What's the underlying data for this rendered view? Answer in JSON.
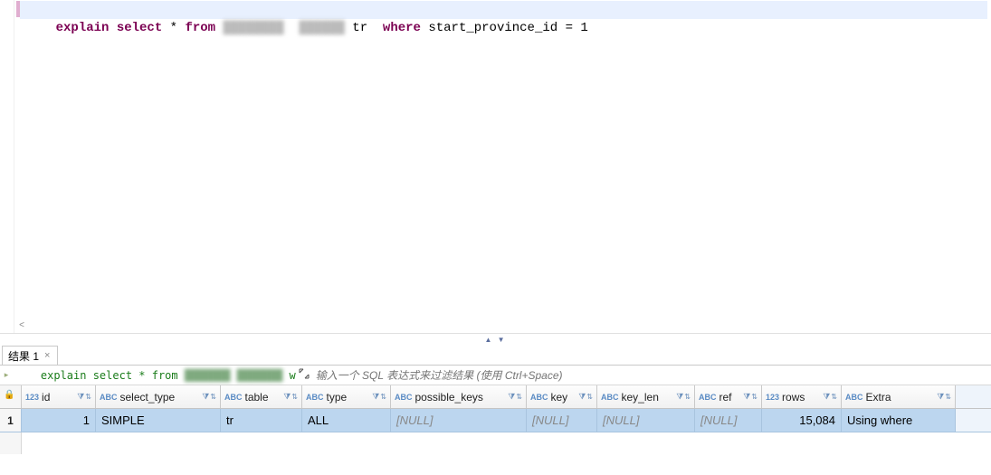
{
  "editor": {
    "sql": {
      "kw_explain": "explain",
      "kw_select": "select",
      "star": " * ",
      "kw_from": "from",
      "blurred_table": "████████  ██████",
      "alias": " tr  ",
      "kw_where": "where",
      "predicate": " start_province_id = 1"
    }
  },
  "splitter": {
    "handle": "▲ ▼"
  },
  "tabs": {
    "result1_label": "结果 1",
    "close_glyph": "×"
  },
  "filter_bar": {
    "tree_glyph": "▸",
    "sql_prefix": "explain select * from ",
    "sql_blurred": "███████ ███████",
    "sql_suffix": " w",
    "placeholder": "输入一个 SQL 表达式来过滤结果 (使用 Ctrl+Space)"
  },
  "grid": {
    "lock_glyph": "🔒",
    "type_num": "123",
    "type_txt": "ABC",
    "filter_glyph": "⧩",
    "sort_glyph": "⇅",
    "columns": {
      "id": "id",
      "select_type": "select_type",
      "table": "table",
      "type": "type",
      "possible_keys": "possible_keys",
      "key": "key",
      "key_len": "key_len",
      "ref": "ref",
      "rows": "rows",
      "extra": "Extra"
    },
    "rownum": "1",
    "row": {
      "id": "1",
      "select_type": "SIMPLE",
      "table": "tr",
      "type": "ALL",
      "possible_keys": "[NULL]",
      "key": "[NULL]",
      "key_len": "[NULL]",
      "ref": "[NULL]",
      "rows": "15,084",
      "extra": "Using where"
    }
  },
  "chart_data": {
    "type": "table",
    "title": "EXPLAIN result",
    "columns": [
      "id",
      "select_type",
      "table",
      "type",
      "possible_keys",
      "key",
      "key_len",
      "ref",
      "rows",
      "Extra"
    ],
    "rows": [
      [
        1,
        "SIMPLE",
        "tr",
        "ALL",
        null,
        null,
        null,
        null,
        15084,
        "Using where"
      ]
    ]
  }
}
